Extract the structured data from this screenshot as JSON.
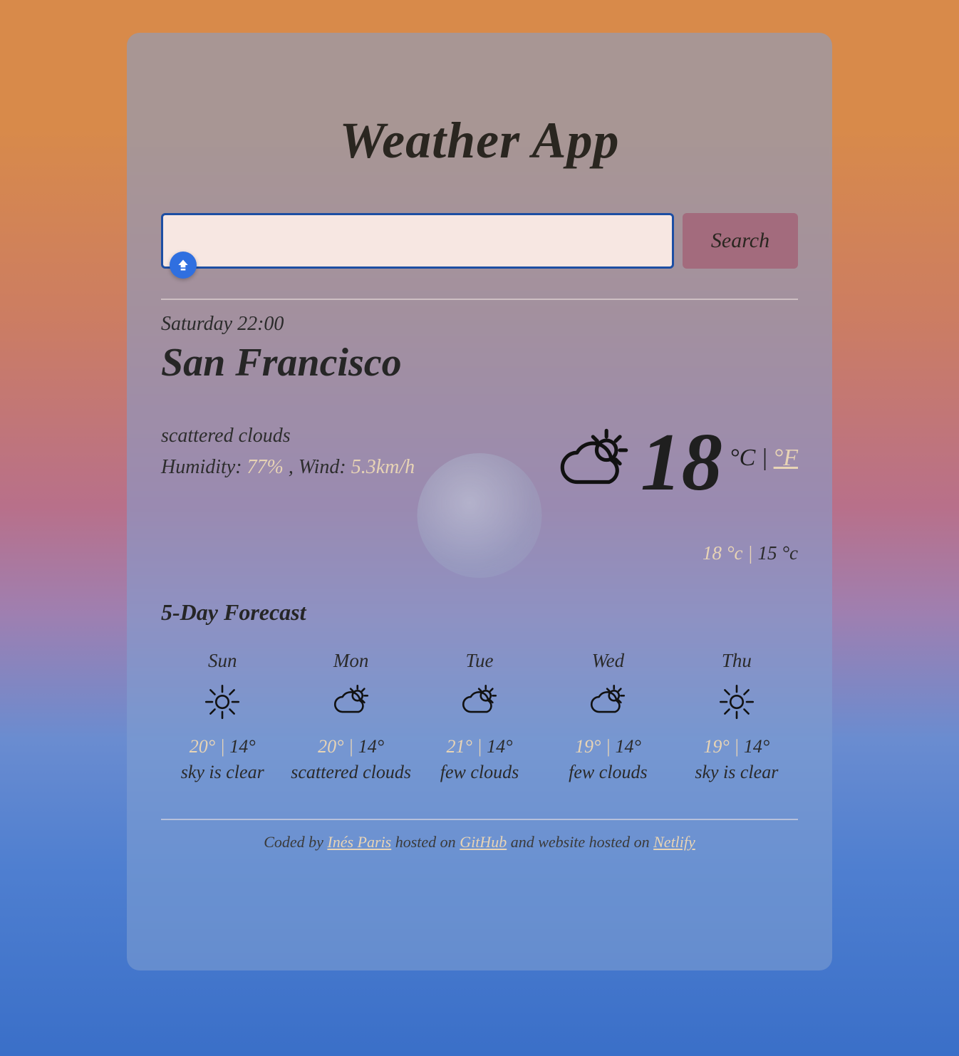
{
  "app": {
    "title": "Weather App"
  },
  "search": {
    "placeholder": "",
    "button_label": "Search",
    "value": ""
  },
  "current": {
    "datetime": "Saturday 22:00",
    "city": "San Francisco",
    "description": "scattered clouds",
    "humidity_label": "Humidity: ",
    "humidity_value": "77%",
    "wind_label": " , Wind: ",
    "wind_value": "5.3km/h",
    "temp": "18",
    "unit_c": "°C",
    "unit_sep": " | ",
    "unit_f": "°F",
    "hi": "18 °c",
    "hl_sep": " | ",
    "lo": "15 °c",
    "icon": "partly-cloudy"
  },
  "forecast_title": "5-Day Forecast",
  "forecast": [
    {
      "day": "Sun",
      "icon": "sunny",
      "hi": "20°",
      "lo": "14°",
      "desc": "sky is clear"
    },
    {
      "day": "Mon",
      "icon": "partly-cloudy",
      "hi": "20°",
      "lo": "14°",
      "desc": "scattered clouds"
    },
    {
      "day": "Tue",
      "icon": "partly-cloudy",
      "hi": "21°",
      "lo": "14°",
      "desc": "few clouds"
    },
    {
      "day": "Wed",
      "icon": "partly-cloudy",
      "hi": "19°",
      "lo": "14°",
      "desc": "few clouds"
    },
    {
      "day": "Thu",
      "icon": "sunny",
      "hi": "19°",
      "lo": "14°",
      "desc": "sky is clear"
    }
  ],
  "footer": {
    "pre": "Coded by ",
    "author": "Inés Paris",
    "mid1": " hosted on ",
    "link1": "GitHub",
    "mid2": " and website hosted on ",
    "link2": "Netlify"
  },
  "icons": {
    "sunny": "sun-icon",
    "partly-cloudy": "sun-cloud-icon"
  }
}
